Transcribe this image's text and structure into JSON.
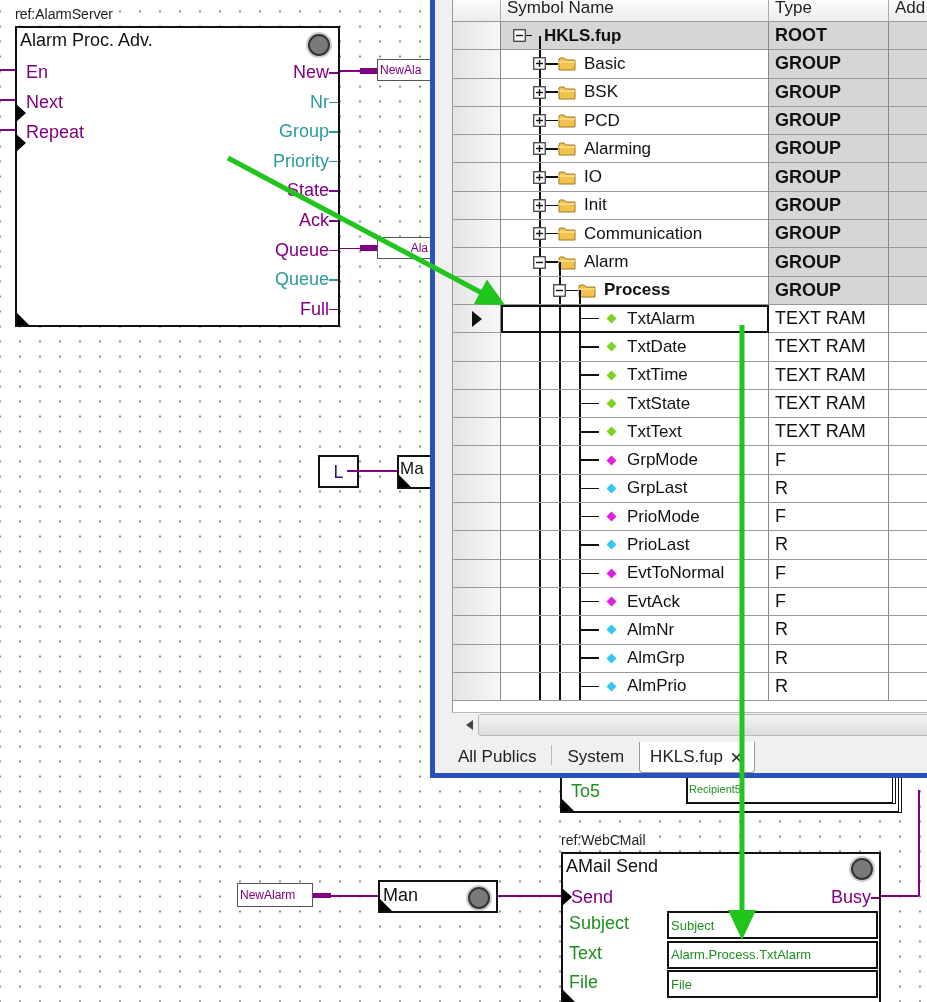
{
  "diagram": {
    "alarm_block": {
      "ref": "ref:AlarmServer",
      "title": "Alarm Proc. Adv.",
      "inputs": [
        {
          "label": "En",
          "kind": "plain"
        },
        {
          "label": "Next",
          "kind": "edge"
        },
        {
          "label": "Repeat",
          "kind": "edge"
        }
      ],
      "outputs": [
        {
          "label": "New",
          "color": "#800080"
        },
        {
          "label": "Nr",
          "color": "#2a9a9a"
        },
        {
          "label": "Group",
          "color": "#2a9a9a"
        },
        {
          "label": "Priority",
          "color": "#2a9a9a"
        },
        {
          "label": "State",
          "color": "#800080"
        },
        {
          "label": "Ack",
          "color": "#800080"
        },
        {
          "label": "Queue",
          "color": "#800080"
        },
        {
          "label": "Queue",
          "color": "#2a9a9a"
        },
        {
          "label": "Full",
          "color": "#800080"
        }
      ]
    },
    "output_tags": [
      "NewAla",
      "Ala"
    ],
    "constant": "L",
    "partial_block": "Ma",
    "recipient_row": {
      "label": "To5",
      "value": "Recipient5"
    },
    "trigger_tag": "NewAlarm",
    "manual_block": "Man",
    "mail_block": {
      "ref": "ref:WebCMail",
      "title": "AMail Send",
      "input": "Send",
      "output": "Busy",
      "params": [
        {
          "label": "Subject",
          "value": "Subject"
        },
        {
          "label": "Text",
          "value": "Alarm.Process.TxtAlarm"
        },
        {
          "label": "File",
          "value": "File"
        }
      ]
    }
  },
  "symbol_window": {
    "columns": [
      "Symbol Name",
      "Type",
      "Add"
    ],
    "tree": [
      {
        "name": "HKLS.fup",
        "type": "ROOT",
        "kind": "root",
        "expanded": true,
        "selected": false,
        "children": [
          {
            "name": "Basic",
            "type": "GROUP",
            "kind": "group",
            "expanded": false,
            "current": false,
            "selected": false
          },
          {
            "name": "BSK",
            "type": "GROUP",
            "kind": "group",
            "expanded": false,
            "current": false,
            "selected": false
          },
          {
            "name": "PCD",
            "type": "GROUP",
            "kind": "group",
            "expanded": false,
            "current": false,
            "selected": false
          },
          {
            "name": "Alarming",
            "type": "GROUP",
            "kind": "group",
            "expanded": false,
            "current": false,
            "selected": false
          },
          {
            "name": "IO",
            "type": "GROUP",
            "kind": "group",
            "expanded": false,
            "current": false,
            "selected": false
          },
          {
            "name": "Init",
            "type": "GROUP",
            "kind": "group",
            "expanded": false,
            "current": false,
            "selected": false
          },
          {
            "name": "Communication",
            "type": "GROUP",
            "kind": "group",
            "expanded": false,
            "current": false,
            "selected": false
          },
          {
            "name": "Alarm",
            "type": "GROUP",
            "kind": "group",
            "expanded": true,
            "current": false,
            "selected": false,
            "children": [
              {
                "name": "Process",
                "type": "GROUP",
                "kind": "group",
                "expanded": true,
                "current": true,
                "selected": false,
                "children": [
                  {
                    "name": "TxtAlarm",
                    "type": "TEXT RAM",
                    "kind": "symbol",
                    "color": "#7ed321",
                    "selected": true
                  },
                  {
                    "name": "TxtDate",
                    "type": "TEXT RAM",
                    "kind": "symbol",
                    "color": "#7ed321",
                    "selected": false
                  },
                  {
                    "name": "TxtTime",
                    "type": "TEXT RAM",
                    "kind": "symbol",
                    "color": "#7ed321",
                    "selected": false
                  },
                  {
                    "name": "TxtState",
                    "type": "TEXT RAM",
                    "kind": "symbol",
                    "color": "#7ed321",
                    "selected": false
                  },
                  {
                    "name": "TxtText",
                    "type": "TEXT RAM",
                    "kind": "symbol",
                    "color": "#7ed321",
                    "selected": false
                  },
                  {
                    "name": "GrpMode",
                    "type": "F",
                    "kind": "symbol",
                    "color": "#e020e0",
                    "selected": false
                  },
                  {
                    "name": "GrpLast",
                    "type": "R",
                    "kind": "symbol",
                    "color": "#30c8f0",
                    "selected": false
                  },
                  {
                    "name": "PrioMode",
                    "type": "F",
                    "kind": "symbol",
                    "color": "#e020e0",
                    "selected": false
                  },
                  {
                    "name": "PrioLast",
                    "type": "R",
                    "kind": "symbol",
                    "color": "#30c8f0",
                    "selected": false
                  },
                  {
                    "name": "EvtToNormal",
                    "type": "F",
                    "kind": "symbol",
                    "color": "#e020e0",
                    "selected": false
                  },
                  {
                    "name": "EvtAck",
                    "type": "F",
                    "kind": "symbol",
                    "color": "#e020e0",
                    "selected": false
                  },
                  {
                    "name": "AlmNr",
                    "type": "R",
                    "kind": "symbol",
                    "color": "#30c8f0",
                    "selected": false
                  },
                  {
                    "name": "AlmGrp",
                    "type": "R",
                    "kind": "symbol",
                    "color": "#30c8f0",
                    "selected": false
                  },
                  {
                    "name": "AlmPrio",
                    "type": "R",
                    "kind": "symbol",
                    "color": "#30c8f0",
                    "selected": false
                  }
                ]
              }
            ]
          }
        ]
      }
    ],
    "tabs": [
      {
        "label": "All Publics",
        "selected": false,
        "closable": false
      },
      {
        "label": "System",
        "selected": false,
        "closable": false
      },
      {
        "label": "HKLS.fup",
        "selected": true,
        "closable": true
      }
    ]
  }
}
